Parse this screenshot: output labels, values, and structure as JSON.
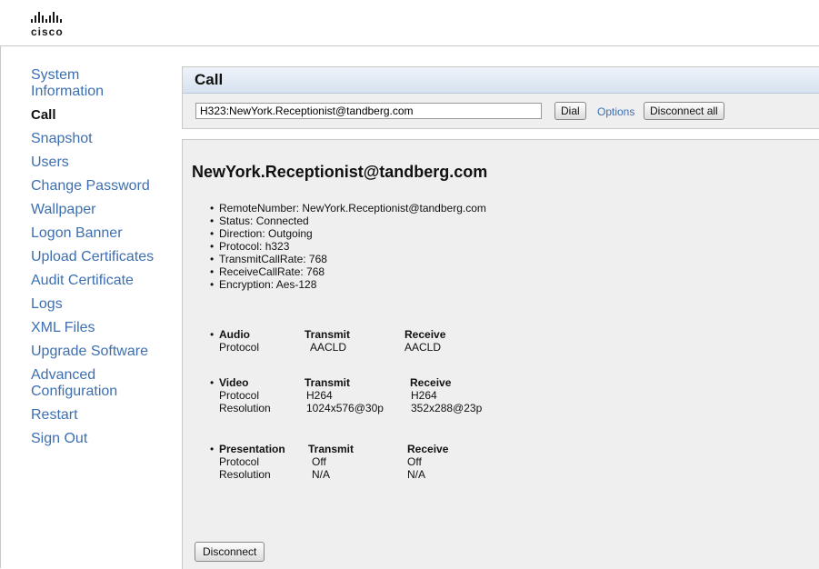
{
  "brand": {
    "logo_text": "cisco"
  },
  "sidebar": {
    "items": [
      {
        "label": "System Information",
        "active": false
      },
      {
        "label": "Call",
        "active": true
      },
      {
        "label": "Snapshot",
        "active": false
      },
      {
        "label": "Users",
        "active": false
      },
      {
        "label": "Change Password",
        "active": false
      },
      {
        "label": "Wallpaper",
        "active": false
      },
      {
        "label": "Logon Banner",
        "active": false
      },
      {
        "label": "Upload Certificates",
        "active": false
      },
      {
        "label": "Audit Certificate",
        "active": false
      },
      {
        "label": "Logs",
        "active": false
      },
      {
        "label": "XML Files",
        "active": false
      },
      {
        "label": "Upgrade Software",
        "active": false
      },
      {
        "label": "Advanced Configuration",
        "active": false
      },
      {
        "label": "Restart",
        "active": false
      },
      {
        "label": "Sign Out",
        "active": false
      }
    ]
  },
  "call": {
    "title": "Call",
    "dial_value": "H323:NewYork.Receptionist@tandberg.com",
    "dial_label": "Dial",
    "options_label": "Options",
    "disconnect_all_label": "Disconnect all"
  },
  "details": {
    "remote_title": "NewYork.Receptionist@tandberg.com",
    "info": [
      "RemoteNumber: NewYork.Receptionist@tandberg.com",
      "Status: Connected",
      "Direction: Outgoing",
      "Protocol: h323",
      "TransmitCallRate: 768",
      "ReceiveCallRate: 768",
      "Encryption: Aes-128"
    ],
    "media": {
      "audio": {
        "name": "Audio",
        "transmit_header": "Transmit",
        "receive_header": "Receive",
        "protocol_label": "Protocol",
        "protocol_tx": "AACLD",
        "protocol_rx": "AACLD"
      },
      "video": {
        "name": "Video",
        "transmit_header": "Transmit",
        "receive_header": "Receive",
        "protocol_label": "Protocol",
        "protocol_tx": "H264",
        "protocol_rx": "H264",
        "resolution_label": "Resolution",
        "resolution_tx": "1024x576@30p",
        "resolution_rx": "352x288@23p"
      },
      "presentation": {
        "name": "Presentation",
        "transmit_header": "Transmit",
        "receive_header": "Receive",
        "protocol_label": "Protocol",
        "protocol_tx": "Off",
        "protocol_rx": "Off",
        "resolution_label": "Resolution",
        "resolution_tx": "N/A",
        "resolution_rx": "N/A"
      }
    },
    "disconnect_label": "Disconnect"
  }
}
